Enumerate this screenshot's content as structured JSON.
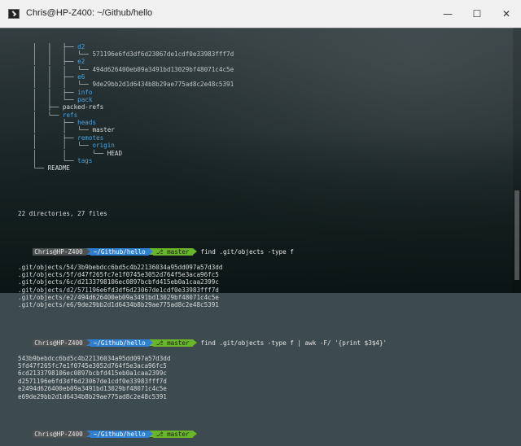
{
  "window": {
    "title": "Chris@HP-Z400: ~/Github/hello",
    "minimize_glyph": "—",
    "maximize_glyph": "☐",
    "close_glyph": "✕"
  },
  "tree": [
    {
      "prefix": "    │   │   ├── ",
      "text": "d2",
      "kind": "dir"
    },
    {
      "prefix": "    │   │   │   └── ",
      "text": "571196e6fd3df6d23067de1cdf0e33983fff7d",
      "kind": "hash"
    },
    {
      "prefix": "    │   │   ├── ",
      "text": "e2",
      "kind": "dir"
    },
    {
      "prefix": "    │   │   │   └── ",
      "text": "494d626400eb09a3491bd13029bf48071c4c5e",
      "kind": "hash"
    },
    {
      "prefix": "    │   │   ├── ",
      "text": "e6",
      "kind": "dir"
    },
    {
      "prefix": "    │   │   │   └── ",
      "text": "9de29bb2d1d6434b8b29ae775ad8c2e48c5391",
      "kind": "hash"
    },
    {
      "prefix": "    │   │   ├── ",
      "text": "info",
      "kind": "dir"
    },
    {
      "prefix": "    │   │   └── ",
      "text": "pack",
      "kind": "dir"
    },
    {
      "prefix": "    │   ├── ",
      "text": "packed-refs",
      "kind": "file"
    },
    {
      "prefix": "    │   └── ",
      "text": "refs",
      "kind": "dir"
    },
    {
      "prefix": "    │       ├── ",
      "text": "heads",
      "kind": "dir"
    },
    {
      "prefix": "    │       │   └── ",
      "text": "master",
      "kind": "file"
    },
    {
      "prefix": "    │       ├── ",
      "text": "remotes",
      "kind": "dir"
    },
    {
      "prefix": "    │       │   └── ",
      "text": "origin",
      "kind": "dir"
    },
    {
      "prefix": "    │       │       └── ",
      "text": "HEAD",
      "kind": "file"
    },
    {
      "prefix": "    │       └── ",
      "text": "tags",
      "kind": "dir"
    },
    {
      "prefix": "    └── ",
      "text": "README",
      "kind": "file"
    }
  ],
  "summary": "22 directories, 27 files",
  "prompt": {
    "user": "Chris@HP-Z400",
    "path": "~/Github/hello",
    "branch": "master"
  },
  "commands": {
    "first": "find .git/objects -type f",
    "second": "find .git/objects -type f | awk -F/ '{print $3$4}'"
  },
  "find_output": [
    ".git/objects/54/3b9bebdcc6bd5c4b22136034a95dd097a57d3dd",
    ".git/objects/5f/d47f265fc7e1f0745e3052d764f5e3aca96fc5",
    ".git/objects/6c/d2133798106ec0897bcbfd415eb0a1caa2399c",
    ".git/objects/d2/571196e6fd3df6d23067de1cdf0e33983fff7d",
    ".git/objects/e2/494d626400eb09a3491bd13029bf48071c4c5e",
    ".git/objects/e6/9de29bb2d1d6434b8b29ae775ad8c2e48c5391"
  ],
  "awk_output": [
    "543b9bebdcc6bd5c4b22136034a95dd097a57d3dd",
    "5fd47f265fc7e1f0745e3052d764f5e3aca96fc5",
    "6cd2133798106ec0897bcbfd415eb0a1caa2399c",
    "d2571196e6fd3df6d23067de1cdf0e33983fff7d",
    "e2494d626400eb09a3491bd13029bf48071c4c5e",
    "e69de29bb2d1d6434b8b29ae775ad8c2e48c5391"
  ],
  "colors": {
    "dir": "#4aa3df",
    "path_segment": "#2f7fd0",
    "branch_segment": "#6ab52a",
    "user_segment": "#4d5152"
  }
}
